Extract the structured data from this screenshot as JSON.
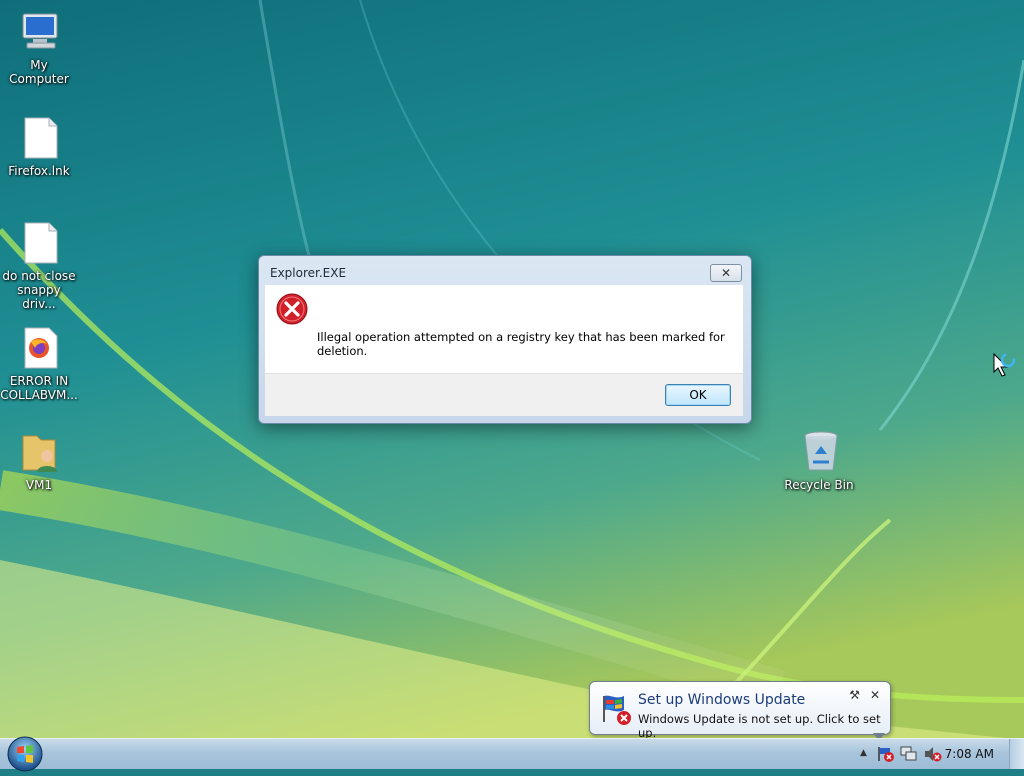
{
  "desktop": {
    "icons": [
      {
        "label": "My Computer",
        "icon": "computer-icon"
      },
      {
        "label": "Firefox.lnk",
        "icon": "file-icon"
      },
      {
        "label": "do not close snappy driv...",
        "icon": "file-icon"
      },
      {
        "label": "ERROR IN COLLABVM...",
        "icon": "firefox-icon"
      },
      {
        "label": "VM1",
        "icon": "user-folder-icon"
      },
      {
        "label": "Recycle Bin",
        "icon": "recycle-bin-icon"
      }
    ]
  },
  "dialog": {
    "title": "Explorer.EXE",
    "close_label": "✕",
    "message": "Illegal operation attempted on a registry key that has been marked for deletion.",
    "icon": "error-icon",
    "ok_label": "OK"
  },
  "notification": {
    "title": "Set up Windows Update",
    "text": "Windows Update is not set up. Click to set up.",
    "close_label": "✕",
    "options_label": "⚒"
  },
  "taskbar": {
    "clock": "7:08 AM",
    "show_hidden_label": "▲"
  },
  "colors": {
    "error_red": "#d2202a",
    "taskbar": "#a9c5dc",
    "balloon_title": "#1c3c7a"
  }
}
